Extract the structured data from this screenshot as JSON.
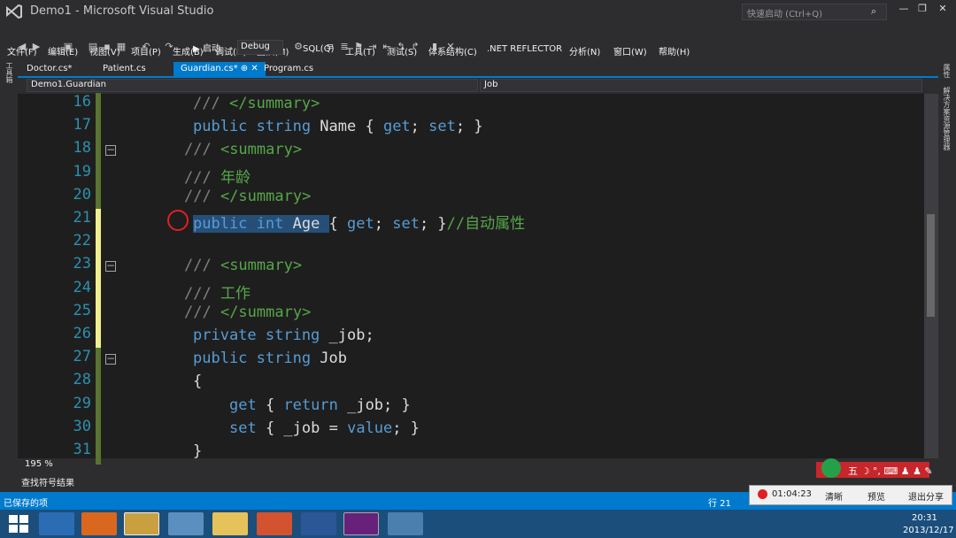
{
  "window": {
    "title": "Demo1 - Microsoft Visual Studio",
    "quick_launch_placeholder": "快速启动 (Ctrl+Q)",
    "minimize": "—",
    "maximize": "❐",
    "close": "✕"
  },
  "menu": [
    "文件(F)",
    "编辑(E)",
    "视图(V)",
    "项目(P)",
    "生成(B)",
    "调试(D)",
    "团队(M)",
    "SQL(Q)",
    "工具(T)",
    "测试(S)",
    "体系结构(C)",
    ".NET REFLECTOR",
    "分析(N)",
    "窗口(W)",
    "帮助(H)"
  ],
  "toolbar": {
    "start_label": "▶ 启动",
    "config": "Debug"
  },
  "left_strip_label": "工具箱",
  "right_strip_labels": [
    "属性",
    "解决方案资源管理器"
  ],
  "tabs": [
    {
      "label": "Doctor.cs*",
      "active": false
    },
    {
      "label": "Patient.cs",
      "active": false
    },
    {
      "label": "Guardian.cs*  ⊕ ✕",
      "active": true
    },
    {
      "label": "Program.cs",
      "active": false
    }
  ],
  "nav": {
    "left": "Demo1.Guardian",
    "right": "Job"
  },
  "code_lines": [
    {
      "n": "16",
      "indent": 218,
      "parts": [
        [
          "cmg",
          "/// "
        ],
        [
          "cm",
          "</summary>"
        ]
      ]
    },
    {
      "n": "17",
      "indent": 218,
      "parts": [
        [
          "kw",
          "public string "
        ],
        [
          "",
          "Name { "
        ],
        [
          "kw",
          "get"
        ],
        [
          "",
          "; "
        ],
        [
          "kw",
          "set"
        ],
        [
          "",
          "; }"
        ]
      ]
    },
    {
      "n": "18",
      "indent": 208,
      "parts": [
        [
          "cmg",
          "/// "
        ],
        [
          "cm",
          "<summary>"
        ]
      ],
      "fold": true
    },
    {
      "n": "19",
      "indent": 208,
      "parts": [
        [
          "cmg",
          "/// "
        ],
        [
          "cm",
          "年龄"
        ]
      ]
    },
    {
      "n": "20",
      "indent": 208,
      "parts": [
        [
          "cmg",
          "/// "
        ],
        [
          "cm",
          "</summary>"
        ]
      ]
    },
    {
      "n": "21",
      "indent": 218,
      "parts": [
        [
          "kw hl",
          "public int "
        ],
        [
          "hl",
          "Age "
        ],
        [
          "",
          "{ "
        ],
        [
          "kw",
          "get"
        ],
        [
          "",
          "; "
        ],
        [
          "kw",
          "set"
        ],
        [
          "",
          "; }"
        ],
        [
          "cm",
          "//自动属性"
        ]
      ]
    },
    {
      "n": "22",
      "indent": 218,
      "parts": []
    },
    {
      "n": "23",
      "indent": 208,
      "parts": [
        [
          "cmg",
          "/// "
        ],
        [
          "cm",
          "<summary>"
        ]
      ],
      "fold": true
    },
    {
      "n": "24",
      "indent": 208,
      "parts": [
        [
          "cmg",
          "/// "
        ],
        [
          "cm",
          "工作"
        ]
      ]
    },
    {
      "n": "25",
      "indent": 208,
      "parts": [
        [
          "cmg",
          "/// "
        ],
        [
          "cm",
          "</summary>"
        ]
      ]
    },
    {
      "n": "26",
      "indent": 218,
      "parts": [
        [
          "kw",
          "private string "
        ],
        [
          "",
          "_job;"
        ]
      ]
    },
    {
      "n": "27",
      "indent": 218,
      "parts": [
        [
          "kw",
          "public string "
        ],
        [
          "",
          "Job"
        ]
      ],
      "fold": true
    },
    {
      "n": "28",
      "indent": 218,
      "parts": [
        [
          "",
          "{"
        ]
      ]
    },
    {
      "n": "29",
      "indent": 259,
      "parts": [
        [
          "kw",
          "get "
        ],
        [
          "",
          "{ "
        ],
        [
          "kw",
          "return "
        ],
        [
          "",
          "_job; }"
        ]
      ]
    },
    {
      "n": "30",
      "indent": 259,
      "parts": [
        [
          "kw",
          "set "
        ],
        [
          "",
          "{ _job = "
        ],
        [
          "kw",
          "value"
        ],
        [
          "",
          "; }"
        ]
      ]
    },
    {
      "n": "31",
      "indent": 218,
      "parts": [
        [
          "",
          "}"
        ]
      ]
    }
  ],
  "zoom": "195 %",
  "find_panel_label": "查找符号结果",
  "status": {
    "left": "已保存的项",
    "line": "行 21"
  },
  "recorder": {
    "time": "01:04:23",
    "clear": "清晰",
    "preview": "预览",
    "exit_share": "退出分享"
  },
  "ime_label": "五 ☽ °, ⌨ ♟ ♟ ✎",
  "clock": {
    "time": "20:31",
    "date": "2013/12/17"
  },
  "colors": {
    "accent": "#007acc",
    "editor_bg": "#1e1e1e",
    "keyword": "#569cd6",
    "comment": "#57a64a",
    "line_number": "#2b91af"
  }
}
